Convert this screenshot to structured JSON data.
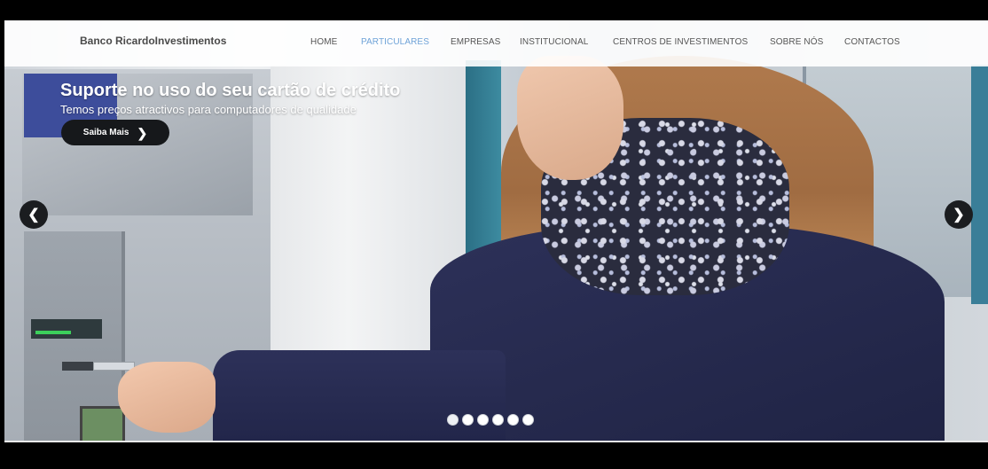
{
  "brand": "Banco RicardoInvestimentos",
  "nav": {
    "items": [
      {
        "label": "HOME",
        "active": false
      },
      {
        "label": "PARTICULARES",
        "active": true
      },
      {
        "label": "EMPRESAS",
        "active": false
      },
      {
        "label": "INSTITUCIONAL",
        "active": false
      },
      {
        "label": "CENTROS DE INVESTIMENTOS",
        "active": false
      },
      {
        "label": "SOBRE NÓS",
        "active": false
      },
      {
        "label": "CONTACTOS",
        "active": false
      }
    ],
    "active_color": "#6fa3d8"
  },
  "slider": {
    "title": "Suporte no uso do seu cartão de crédito",
    "subtitle": "Temos preços atractivos para computadores de qualidade",
    "cta_label": "Saiba Mais",
    "cta_icon": "chevron-right-icon",
    "prev_icon": "chevron-left-icon",
    "next_icon": "chevron-right-icon",
    "slide_count": 6,
    "active_slide": 0,
    "image_description_icon": "woman-at-atm-photo"
  }
}
